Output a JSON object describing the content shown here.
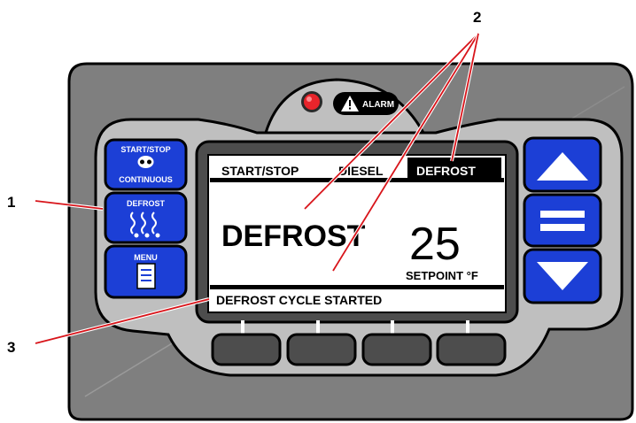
{
  "callouts": {
    "one": "1",
    "two": "2",
    "three": "3"
  },
  "alarm": {
    "label": "ALARM"
  },
  "left_buttons": {
    "start_stop": "START/STOP",
    "continuous": "CONTINUOUS",
    "defrost": "DEFROST",
    "menu": "MENU"
  },
  "display": {
    "tabs": [
      "START/STOP",
      "DIESEL",
      "DEFROST"
    ],
    "mode_text": "DEFROST",
    "setpoint_value": "25",
    "setpoint_label": "SETPOINT °F",
    "status_message": "DEFROST CYCLE STARTED"
  },
  "colors": {
    "body": "#7f7f7f",
    "bezel": "#bfbfbf",
    "button_blue": "#1c3fd6",
    "screen_bg": "#ffffff",
    "callout_red": "#d8141a",
    "alarm_led": "#e8242b"
  }
}
